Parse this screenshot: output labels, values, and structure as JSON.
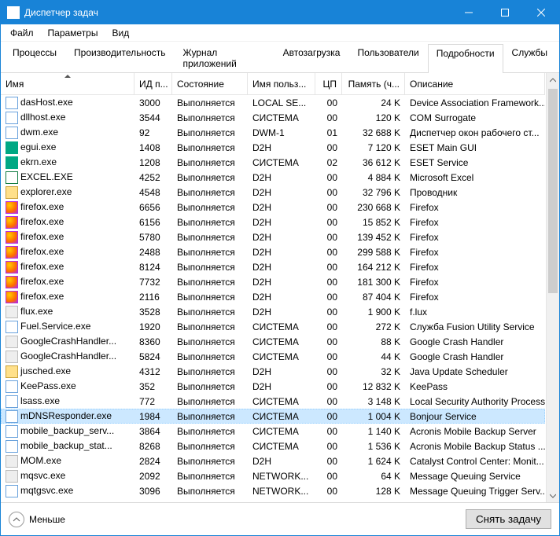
{
  "window": {
    "title": "Диспетчер задач"
  },
  "menu": [
    "Файл",
    "Параметры",
    "Вид"
  ],
  "tabs": [
    "Процессы",
    "Производительность",
    "Журнал приложений",
    "Автозагрузка",
    "Пользователи",
    "Подробности",
    "Службы"
  ],
  "active_tab": 5,
  "columns": {
    "name": "Имя",
    "pid": "ИД п...",
    "state": "Состояние",
    "user": "Имя польз...",
    "cpu": "ЦП",
    "mem": "Память (ч...",
    "desc": "Описание"
  },
  "rows": [
    {
      "ic": "b",
      "name": "dasHost.exe",
      "pid": "3000",
      "state": "Выполняется",
      "user": "LOCAL SE...",
      "cpu": "00",
      "mem": "24 K",
      "desc": "Device Association Framework..."
    },
    {
      "ic": "b",
      "name": "dllhost.exe",
      "pid": "3544",
      "state": "Выполняется",
      "user": "СИСТЕМА",
      "cpu": "00",
      "mem": "120 K",
      "desc": "COM Surrogate"
    },
    {
      "ic": "b",
      "name": "dwm.exe",
      "pid": "92",
      "state": "Выполняется",
      "user": "DWM-1",
      "cpu": "01",
      "mem": "32 688 K",
      "desc": "Диспетчер окон рабочего ст..."
    },
    {
      "ic": "e",
      "name": "egui.exe",
      "pid": "1408",
      "state": "Выполняется",
      "user": "D2H",
      "cpu": "00",
      "mem": "7 120 K",
      "desc": "ESET Main GUI"
    },
    {
      "ic": "e",
      "name": "ekrn.exe",
      "pid": "1208",
      "state": "Выполняется",
      "user": "СИСТЕМА",
      "cpu": "02",
      "mem": "36 612 K",
      "desc": "ESET Service"
    },
    {
      "ic": "x",
      "name": "EXCEL.EXE",
      "pid": "4252",
      "state": "Выполняется",
      "user": "D2H",
      "cpu": "00",
      "mem": "4 884 K",
      "desc": "Microsoft Excel"
    },
    {
      "ic": "y",
      "name": "explorer.exe",
      "pid": "4548",
      "state": "Выполняется",
      "user": "D2H",
      "cpu": "00",
      "mem": "32 796 K",
      "desc": "Проводник"
    },
    {
      "ic": "ff",
      "name": "firefox.exe",
      "pid": "6656",
      "state": "Выполняется",
      "user": "D2H",
      "cpu": "00",
      "mem": "230 668 K",
      "desc": "Firefox"
    },
    {
      "ic": "ff",
      "name": "firefox.exe",
      "pid": "6156",
      "state": "Выполняется",
      "user": "D2H",
      "cpu": "00",
      "mem": "15 852 K",
      "desc": "Firefox"
    },
    {
      "ic": "ff",
      "name": "firefox.exe",
      "pid": "5780",
      "state": "Выполняется",
      "user": "D2H",
      "cpu": "00",
      "mem": "139 452 K",
      "desc": "Firefox"
    },
    {
      "ic": "ff",
      "name": "firefox.exe",
      "pid": "2488",
      "state": "Выполняется",
      "user": "D2H",
      "cpu": "00",
      "mem": "299 588 K",
      "desc": "Firefox"
    },
    {
      "ic": "ff",
      "name": "firefox.exe",
      "pid": "8124",
      "state": "Выполняется",
      "user": "D2H",
      "cpu": "00",
      "mem": "164 212 K",
      "desc": "Firefox"
    },
    {
      "ic": "ff",
      "name": "firefox.exe",
      "pid": "7732",
      "state": "Выполняется",
      "user": "D2H",
      "cpu": "00",
      "mem": "181 300 K",
      "desc": "Firefox"
    },
    {
      "ic": "ff",
      "name": "firefox.exe",
      "pid": "2116",
      "state": "Выполняется",
      "user": "D2H",
      "cpu": "00",
      "mem": "87 404 K",
      "desc": "Firefox"
    },
    {
      "ic": "g",
      "name": "flux.exe",
      "pid": "3528",
      "state": "Выполняется",
      "user": "D2H",
      "cpu": "00",
      "mem": "1 900 K",
      "desc": "f.lux"
    },
    {
      "ic": "b",
      "name": "Fuel.Service.exe",
      "pid": "1920",
      "state": "Выполняется",
      "user": "СИСТЕМА",
      "cpu": "00",
      "mem": "272 K",
      "desc": "Служба Fusion Utility Service"
    },
    {
      "ic": "g",
      "name": "GoogleCrashHandler...",
      "pid": "8360",
      "state": "Выполняется",
      "user": "СИСТЕМА",
      "cpu": "00",
      "mem": "88 K",
      "desc": "Google Crash Handler"
    },
    {
      "ic": "g",
      "name": "GoogleCrashHandler...",
      "pid": "5824",
      "state": "Выполняется",
      "user": "СИСТЕМА",
      "cpu": "00",
      "mem": "44 K",
      "desc": "Google Crash Handler"
    },
    {
      "ic": "y",
      "name": "jusched.exe",
      "pid": "4312",
      "state": "Выполняется",
      "user": "D2H",
      "cpu": "00",
      "mem": "32 K",
      "desc": "Java Update Scheduler"
    },
    {
      "ic": "b",
      "name": "KeePass.exe",
      "pid": "352",
      "state": "Выполняется",
      "user": "D2H",
      "cpu": "00",
      "mem": "12 832 K",
      "desc": "KeePass"
    },
    {
      "ic": "b",
      "name": "lsass.exe",
      "pid": "772",
      "state": "Выполняется",
      "user": "СИСТЕМА",
      "cpu": "00",
      "mem": "3 148 K",
      "desc": "Local Security Authority Process"
    },
    {
      "ic": "b",
      "name": "mDNSResponder.exe",
      "pid": "1984",
      "state": "Выполняется",
      "user": "СИСТЕМА",
      "cpu": "00",
      "mem": "1 004 K",
      "desc": "Bonjour Service",
      "sel": true
    },
    {
      "ic": "b",
      "name": "mobile_backup_serv...",
      "pid": "3864",
      "state": "Выполняется",
      "user": "СИСТЕМА",
      "cpu": "00",
      "mem": "1 140 K",
      "desc": "Acronis Mobile Backup Server"
    },
    {
      "ic": "b",
      "name": "mobile_backup_stat...",
      "pid": "8268",
      "state": "Выполняется",
      "user": "СИСТЕМА",
      "cpu": "00",
      "mem": "1 536 K",
      "desc": "Acronis Mobile Backup Status ..."
    },
    {
      "ic": "g",
      "name": "MOM.exe",
      "pid": "2824",
      "state": "Выполняется",
      "user": "D2H",
      "cpu": "00",
      "mem": "1 624 K",
      "desc": "Catalyst Control Center: Monit..."
    },
    {
      "ic": "g",
      "name": "mqsvc.exe",
      "pid": "2092",
      "state": "Выполняется",
      "user": "NETWORK...",
      "cpu": "00",
      "mem": "64 K",
      "desc": "Message Queuing Service"
    },
    {
      "ic": "b",
      "name": "mqtgsvc.exe",
      "pid": "3096",
      "state": "Выполняется",
      "user": "NETWORK...",
      "cpu": "00",
      "mem": "128 K",
      "desc": "Message Queuing Trigger Serv..."
    }
  ],
  "footer": {
    "fewer": "Меньше",
    "end": "Снять задачу"
  }
}
